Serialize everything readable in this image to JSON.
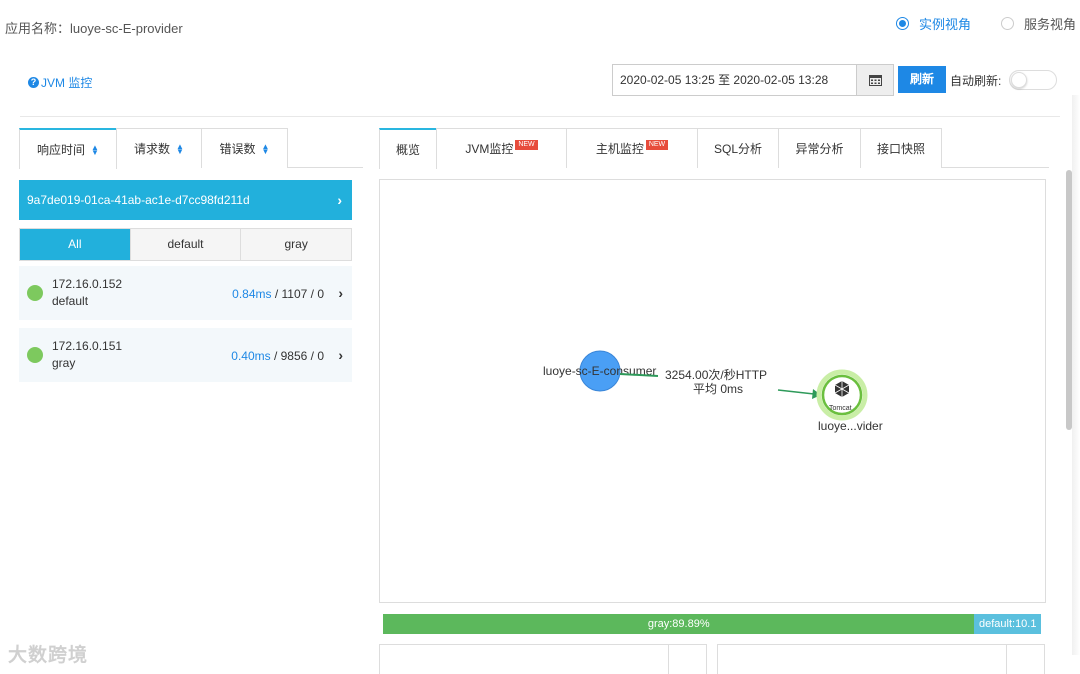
{
  "header": {
    "app_name_label": "应用名称：luoye-sc-E-provider",
    "view_options": [
      {
        "label": "实例视角",
        "checked": true
      },
      {
        "label": "服务视角",
        "checked": false
      }
    ]
  },
  "toolbar": {
    "jvm_link": "JVM 监控",
    "date_range": "2020-02-05 13:25 至 2020-02-05 13:28",
    "refresh_label": "刷新",
    "auto_refresh_label": "自动刷新:",
    "auto_refresh_on": false
  },
  "left_panel": {
    "tabs": [
      {
        "label": "响应时间"
      },
      {
        "label": "请求数"
      },
      {
        "label": "错误数"
      }
    ],
    "instance_id": "9a7de019-01ca-41ab-ac1e-d7cc98fd211d",
    "groups": [
      {
        "label": "All",
        "active": true
      },
      {
        "label": "default",
        "active": false
      },
      {
        "label": "gray",
        "active": false
      }
    ],
    "instances": [
      {
        "ip": "172.16.0.152",
        "group": "default",
        "rt": "0.84ms",
        "rest": " / 1107 / 0"
      },
      {
        "ip": "172.16.0.151",
        "group": "gray",
        "rt": "0.40ms",
        "rest": " / 9856 / 0"
      }
    ]
  },
  "right_panel": {
    "tabs": [
      {
        "label": "概览",
        "new": false
      },
      {
        "label": "JVM监控",
        "new": true
      },
      {
        "label": "主机监控",
        "new": true
      },
      {
        "label": "SQL分析",
        "new": false
      },
      {
        "label": "异常分析",
        "new": false
      },
      {
        "label": "接口快照",
        "new": false
      }
    ],
    "new_badge": "NEW",
    "topology": {
      "consumer_label": "luoye-sc-E-consumer",
      "edge_rate": "3254.00次/秒HTTP",
      "edge_avg": "平均 0ms",
      "provider_label": "luoye...vider",
      "provider_icon_text": "Tomcat"
    },
    "ratio": {
      "gray_label": "gray:89.89%",
      "gray_fraction": 0.8989,
      "default_label": "default:10.1"
    }
  },
  "watermark": "大数跨境",
  "colors": {
    "accent": "#1e88e5",
    "tab_active": "#22b0dc",
    "status_ok": "#7dc95e",
    "consumer_node": "#4a9ff5",
    "gray_ratio": "#5cb85c",
    "default_ratio": "#5bc0de"
  }
}
